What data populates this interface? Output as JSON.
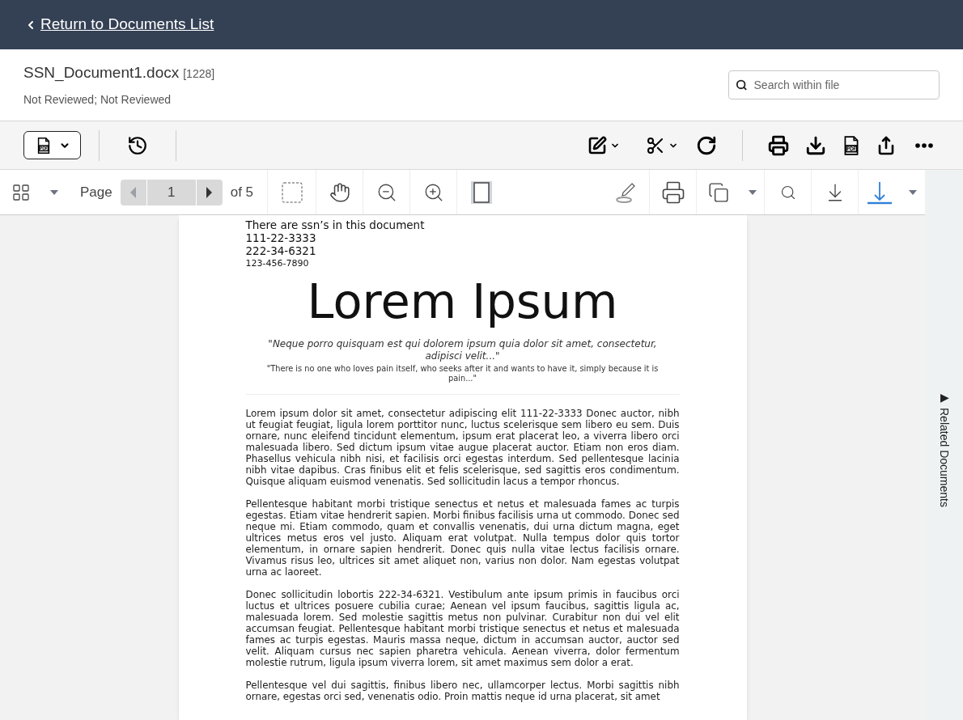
{
  "back_link": {
    "label": "Return to Documents List"
  },
  "document": {
    "filename": "SSN_Document1.docx",
    "id": "[1228]",
    "status": "Not Reviewed; Not Reviewed"
  },
  "search": {
    "placeholder": "Search within file"
  },
  "pager": {
    "label": "Page",
    "value": "1",
    "total": "of 5"
  },
  "sidebar": {
    "label": "Related Documents",
    "arrow": "▶"
  },
  "page": {
    "intro": [
      "There are ssn’s in this document",
      "111-22-3333",
      "222-34-6321"
    ],
    "small_line": "123-456-7890",
    "title": "Lorem Ipsum",
    "quote": "\"Neque porro quisquam est qui dolorem ipsum quia dolor sit amet, consectetur, adipisci velit...\"",
    "subquote": "\"There is no one who loves pain itself, who seeks after it and wants to have it, simply because it is pain...\"",
    "paragraphs": [
      "Lorem ipsum dolor sit amet, consectetur adipiscing elit 111-22-3333 Donec auctor, nibh ut feugiat feugiat, ligula lorem porttitor nunc, luctus scelerisque sem libero eu sem. Duis ornare, nunc eleifend tincidunt elementum, ipsum erat placerat leo, a viverra libero orci malesuada libero. Sed dictum ipsum vitae augue placerat auctor. Etiam non eros diam. Phasellus vehicula nibh nisi, et facilisis orci egestas interdum. Sed pellentesque lacinia nibh vitae dapibus. Cras finibus elit et felis scelerisque, sed sagittis eros condimentum. Quisque aliquam euismod venenatis. Sed sollicitudin lacus a tempor rhoncus.",
      "Pellentesque habitant morbi tristique senectus et netus et malesuada fames ac turpis egestas. Etiam vitae hendrerit sapien. Morbi finibus facilisis urna ut commodo. Donec sed neque mi. Etiam commodo, quam et convallis venenatis, dui urna dictum magna, eget ultrices metus eros vel justo. Aliquam erat volutpat. Nulla tempus dolor quis tortor elementum, in ornare sapien hendrerit. Donec quis nulla vitae lectus facilisis ornare. Vivamus risus leo, ultrices sit amet aliquet non, varius non dolor. Nam egestas volutpat urna ac laoreet.",
      "Donec sollicitudin lobortis 222-34-6321. Vestibulum ante ipsum primis in faucibus orci luctus et ultrices posuere cubilia curae; Aenean vel ipsum faucibus, sagittis ligula ac, malesuada lorem. Sed molestie sagittis metus non pulvinar. Curabitur non dui vel elit accumsan feugiat. Pellentesque habitant morbi tristique senectus et netus et malesuada fames ac turpis egestas. Mauris massa neque, dictum in accumsan auctor, auctor sed velit. Aliquam cursus nec sapien pharetra vehicula. Aenean viverra, dolor fermentum molestie rutrum, ligula ipsum viverra lorem, sit amet maximus sem dolor a erat.",
      "Pellentesque vel dui sagittis, finibus libero nec, ullamcorper lectus. Morbi sagittis nibh ornare, egestas orci sed, venenatis odio. Proin mattis neque id urna placerat, sit amet"
    ]
  }
}
